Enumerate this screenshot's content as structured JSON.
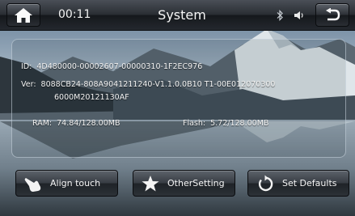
{
  "header": {
    "time": "00:11",
    "title": "System"
  },
  "info": {
    "id_label": "ID:",
    "id_value": "4D480000-00002607-00000310-1F2EC976",
    "ver_label": "Ver:",
    "ver_value_line1": "8088CB24-808A9041211240-V1.1.0.0B10 T1-00E012070300",
    "ver_value_line2": "6000M20121130AF",
    "ram_label": "RAM:",
    "ram_value": "74.84/128.00MB",
    "flash_label": "Flash:",
    "flash_value": "5.72/128.00MB"
  },
  "buttons": {
    "align_touch": "Align touch",
    "other_setting": "OtherSetting",
    "set_defaults": "Set Defaults"
  },
  "icons": {
    "home": "home-icon",
    "back": "back-arrow-icon",
    "bluetooth": "bluetooth-icon",
    "volume": "volume-icon",
    "align": "hand-touch-icon",
    "other": "star-icon",
    "defaults": "reset-icon"
  }
}
